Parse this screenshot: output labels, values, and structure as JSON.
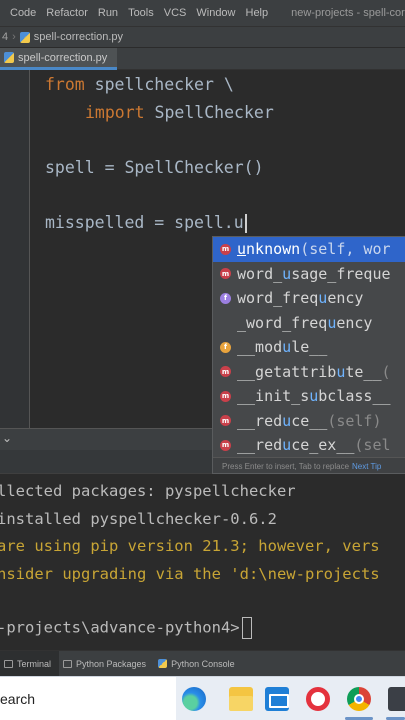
{
  "menu": {
    "items": [
      "Code",
      "Refactor",
      "Run",
      "Tools",
      "VCS",
      "Window",
      "Help"
    ],
    "window_title": "new-projects - spell-correction"
  },
  "breadcrumb": {
    "partial": "4",
    "file": "spell-correction.py"
  },
  "editor": {
    "active_tab": "spell-correction.py",
    "lines": {
      "l1_kw": "from",
      "l1_rest": " spellchecker \\",
      "l2_kw": "import",
      "l2_rest": " SpellChecker",
      "l3": "spell = SpellChecker()",
      "l4": "misspelled = spell.u"
    }
  },
  "completion": {
    "items": [
      {
        "icon": "method",
        "pre": "",
        "hl": "u",
        "post": "nknown",
        "sig": "(self, wor"
      },
      {
        "icon": "method",
        "pre": "word_",
        "hl": "u",
        "post": "sage_freque",
        "sig": ""
      },
      {
        "icon": "function",
        "pre": "word_freq",
        "hl": "u",
        "post": "ency",
        "sig": ""
      },
      {
        "icon": "none",
        "pre": "_word_freq",
        "hl": "u",
        "post": "ency",
        "sig": ""
      },
      {
        "icon": "variable",
        "pre": "__mod",
        "hl": "u",
        "post": "le__",
        "sig": ""
      },
      {
        "icon": "method",
        "pre": "__getattrib",
        "hl": "u",
        "post": "te__",
        "sig": "("
      },
      {
        "icon": "method",
        "pre": "__init_s",
        "hl": "u",
        "post": "bclass__",
        "sig": ""
      },
      {
        "icon": "method",
        "pre": "__red",
        "hl": "u",
        "post": "ce__",
        "sig": "(self)"
      },
      {
        "icon": "method",
        "pre": "__red",
        "hl": "u",
        "post": "ce_ex__",
        "sig": "(sel"
      }
    ],
    "hint": "Press Enter to insert, Tab to replace",
    "hint_link": "Next Tip"
  },
  "terminal": {
    "lines": [
      "llected packages: pyspellchecker",
      "installed pyspellchecker-0.6.2",
      "are using pip version 21.3; however, vers",
      "nsider upgrading via the 'd:\\new-projects",
      "",
      "-projects\\advance-python4>"
    ]
  },
  "tool_windows": {
    "terminal": "Terminal",
    "packages": "Python Packages",
    "console": "Python Console"
  },
  "taskbar": {
    "search_text": "earch"
  },
  "colors": {
    "editor_bg": "#2b2b2b",
    "keyword": "#cc7832",
    "selection": "#2f65ca",
    "warning_text": "#c8a535"
  }
}
